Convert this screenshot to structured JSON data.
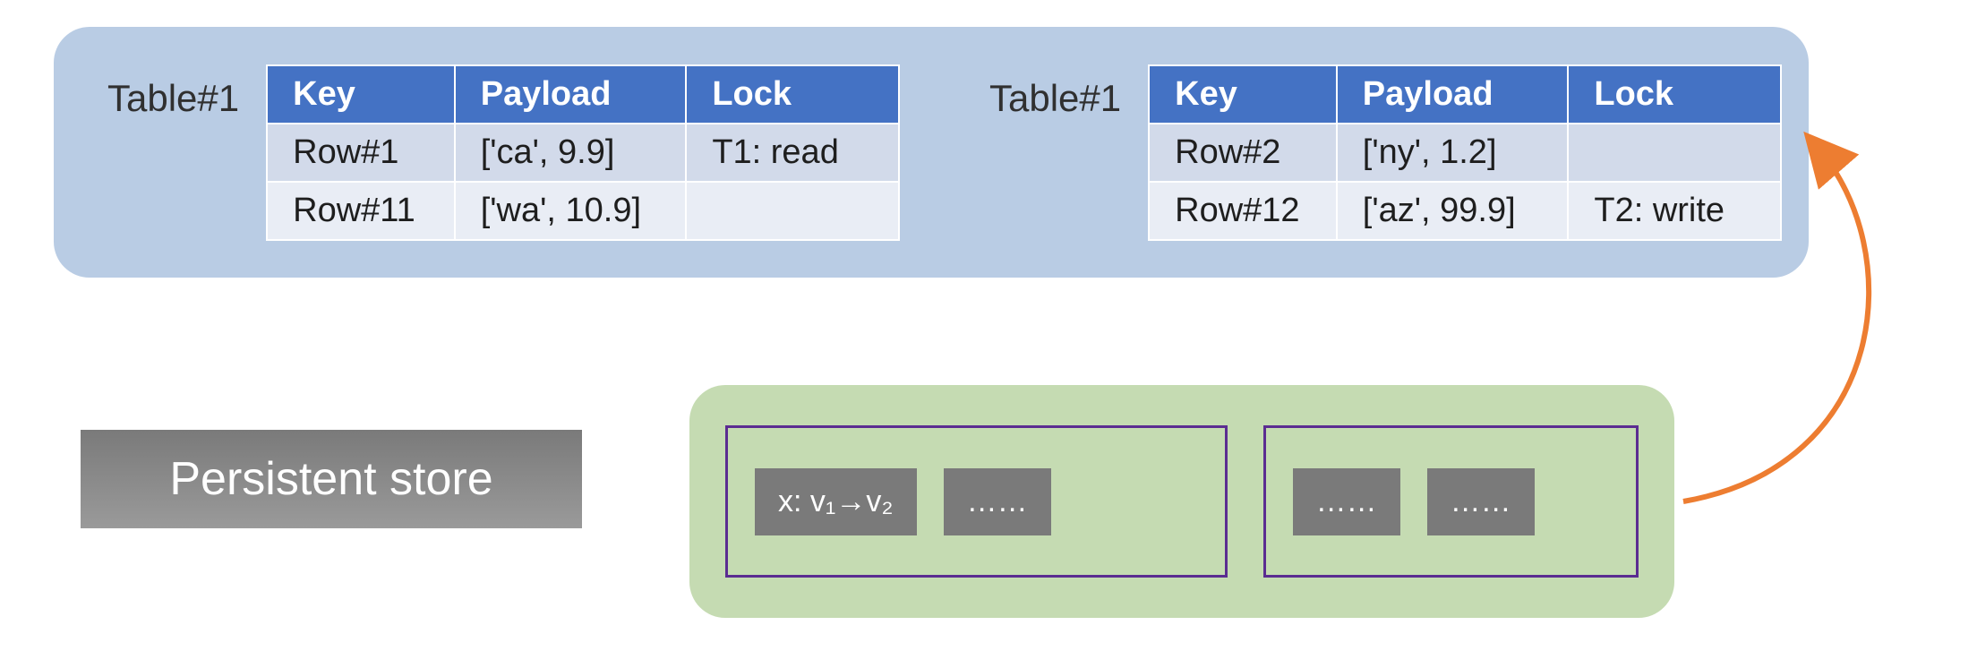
{
  "top": {
    "left": {
      "label": "Table#1",
      "headers": {
        "key": "Key",
        "payload": "Payload",
        "lock": "Lock"
      },
      "rows": [
        {
          "key": "Row#1",
          "payload": "['ca', 9.9]",
          "lock": "T1: read"
        },
        {
          "key": "Row#11",
          "payload": "['wa', 10.9]",
          "lock": ""
        }
      ]
    },
    "right": {
      "label": "Table#1",
      "headers": {
        "key": "Key",
        "payload": "Payload",
        "lock": "Lock"
      },
      "rows": [
        {
          "key": "Row#2",
          "payload": "['ny', 1.2]",
          "lock": ""
        },
        {
          "key": "Row#12",
          "payload": "['az', 99.9]",
          "lock": "T2: write"
        }
      ]
    }
  },
  "store_label": "Persistent store",
  "log": {
    "group1": {
      "entry1": "x: v₁→v₂",
      "entry2": "……"
    },
    "group2": {
      "entry1": "……",
      "entry2": "……"
    }
  },
  "colors": {
    "panel_blue": "#b9cce4",
    "panel_green": "#c5dbb2",
    "table_header": "#4472c4",
    "log_border": "#5b2c91",
    "arrow": "#ed7d31"
  }
}
